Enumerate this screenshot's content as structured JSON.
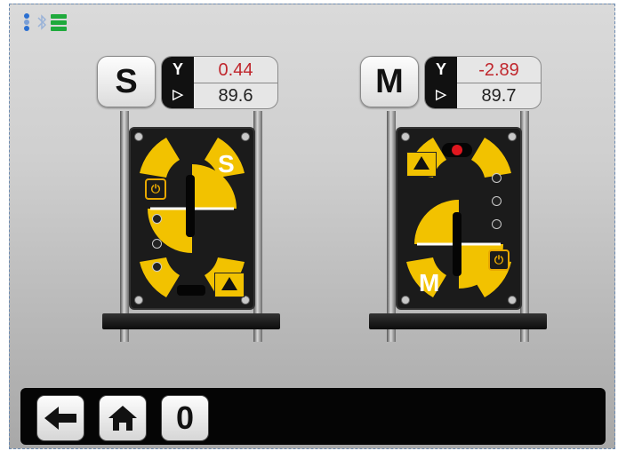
{
  "status_bar": {
    "bluetooth_icon": "bluetooth-icon",
    "battery_icon": "battery-icon",
    "battery_color": "#1faa3c"
  },
  "units": [
    {
      "id": "S",
      "tag_label": "S",
      "readout": {
        "row1_label": "Y",
        "row1_value": "0.44",
        "row1_color": "#c0262c",
        "row2_label": "▷",
        "row2_value": "89.6"
      },
      "body_letter": "S"
    },
    {
      "id": "M",
      "tag_label": "M",
      "readout": {
        "row1_label": "Y",
        "row1_value": "-2.89",
        "row1_color": "#c0262c",
        "row2_label": "▷",
        "row2_value": "89.7"
      },
      "body_letter": "M"
    }
  ],
  "toolbar": {
    "back_icon": "arrow-left-icon",
    "home_icon": "home-icon",
    "counter_label": "0"
  },
  "colors": {
    "accent_yellow": "#f2c200",
    "value_red": "#c0262c"
  }
}
